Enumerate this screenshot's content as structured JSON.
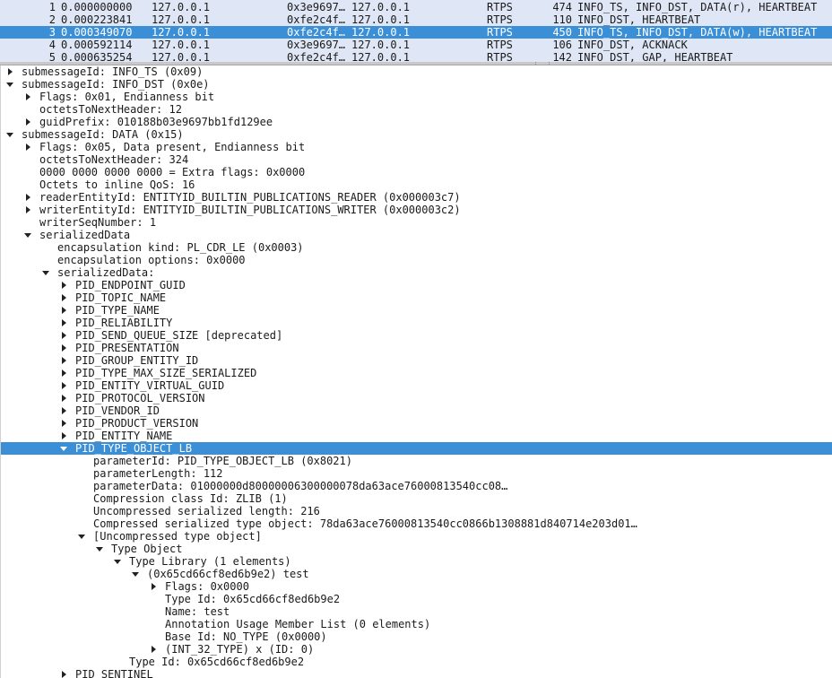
{
  "colors": {
    "selection": "#3b8fd6",
    "packet_list_bg": "#dfe6f5"
  },
  "packet_list": {
    "rows": [
      {
        "no": "1",
        "time": "0.000000000",
        "src": "127.0.0.1",
        "dst": "0x3e9697…",
        "dst2": "127.0.0.1",
        "proto": "RTPS",
        "len": "474",
        "info": "INFO_TS, INFO_DST, DATA(r), HEARTBEAT",
        "selected": false
      },
      {
        "no": "2",
        "time": "0.000223841",
        "src": "127.0.0.1",
        "dst": "0xfe2c4f…",
        "dst2": "127.0.0.1",
        "proto": "RTPS",
        "len": "110",
        "info": "INFO_DST, HEARTBEAT",
        "selected": false
      },
      {
        "no": "3",
        "time": "0.000349070",
        "src": "127.0.0.1",
        "dst": "0xfe2c4f…",
        "dst2": "127.0.0.1",
        "proto": "RTPS",
        "len": "450",
        "info": "INFO_TS, INFO_DST, DATA(w), HEARTBEAT",
        "selected": true
      },
      {
        "no": "4",
        "time": "0.000592114",
        "src": "127.0.0.1",
        "dst": "0x3e9697…",
        "dst2": "127.0.0.1",
        "proto": "RTPS",
        "len": "106",
        "info": "INFO_DST, ACKNACK",
        "selected": false
      },
      {
        "no": "5",
        "time": "0.000635254",
        "src": "127.0.0.1",
        "dst": "0xfe2c4f…",
        "dst2": "127.0.0.1",
        "proto": "RTPS",
        "len": "142",
        "info": "INFO_DST, GAP, HEARTBEAT",
        "selected": false
      }
    ]
  },
  "detail_tree": {
    "rows": [
      {
        "depth": 1,
        "expander": "collapsed",
        "text": "submessageId: INFO_TS (0x09)"
      },
      {
        "depth": 1,
        "expander": "expanded",
        "text": "submessageId: INFO_DST (0x0e)"
      },
      {
        "depth": 2,
        "expander": "collapsed",
        "text": "Flags: 0x01, Endianness bit"
      },
      {
        "depth": 2,
        "expander": "none",
        "text": "octetsToNextHeader: 12"
      },
      {
        "depth": 2,
        "expander": "collapsed",
        "text": "guidPrefix: 010188b03e9697bb1fd129ee"
      },
      {
        "depth": 1,
        "expander": "expanded",
        "text": "submessageId: DATA (0x15)"
      },
      {
        "depth": 2,
        "expander": "collapsed",
        "text": "Flags: 0x05, Data present, Endianness bit"
      },
      {
        "depth": 2,
        "expander": "none",
        "text": "octetsToNextHeader: 324"
      },
      {
        "depth": 2,
        "expander": "none",
        "text": "0000 0000 0000 0000 = Extra flags: 0x0000"
      },
      {
        "depth": 2,
        "expander": "none",
        "text": "Octets to inline QoS: 16"
      },
      {
        "depth": 2,
        "expander": "collapsed",
        "text": "readerEntityId: ENTITYID_BUILTIN_PUBLICATIONS_READER (0x000003c7)"
      },
      {
        "depth": 2,
        "expander": "collapsed",
        "text": "writerEntityId: ENTITYID_BUILTIN_PUBLICATIONS_WRITER (0x000003c2)"
      },
      {
        "depth": 2,
        "expander": "none",
        "text": "writerSeqNumber: 1"
      },
      {
        "depth": 2,
        "expander": "expanded",
        "text": "serializedData"
      },
      {
        "depth": 3,
        "expander": "none",
        "text": "encapsulation kind: PL_CDR_LE (0x0003)"
      },
      {
        "depth": 3,
        "expander": "none",
        "text": "encapsulation options: 0x0000"
      },
      {
        "depth": 3,
        "expander": "expanded",
        "text": "serializedData:"
      },
      {
        "depth": 4,
        "expander": "collapsed",
        "text": "PID_ENDPOINT_GUID"
      },
      {
        "depth": 4,
        "expander": "collapsed",
        "text": "PID_TOPIC_NAME"
      },
      {
        "depth": 4,
        "expander": "collapsed",
        "text": "PID_TYPE_NAME"
      },
      {
        "depth": 4,
        "expander": "collapsed",
        "text": "PID_RELIABILITY"
      },
      {
        "depth": 4,
        "expander": "collapsed",
        "text": "PID_SEND_QUEUE_SIZE [deprecated]"
      },
      {
        "depth": 4,
        "expander": "collapsed",
        "text": "PID_PRESENTATION"
      },
      {
        "depth": 4,
        "expander": "collapsed",
        "text": "PID_GROUP_ENTITY_ID"
      },
      {
        "depth": 4,
        "expander": "collapsed",
        "text": "PID_TYPE_MAX_SIZE_SERIALIZED"
      },
      {
        "depth": 4,
        "expander": "collapsed",
        "text": "PID_ENTITY_VIRTUAL_GUID"
      },
      {
        "depth": 4,
        "expander": "collapsed",
        "text": "PID_PROTOCOL_VERSION"
      },
      {
        "depth": 4,
        "expander": "collapsed",
        "text": "PID_VENDOR_ID"
      },
      {
        "depth": 4,
        "expander": "collapsed",
        "text": "PID_PRODUCT_VERSION"
      },
      {
        "depth": 4,
        "expander": "collapsed",
        "text": "PID_ENTITY_NAME"
      },
      {
        "depth": 4,
        "expander": "expanded",
        "text": "PID_TYPE_OBJECT_LB",
        "selected": true
      },
      {
        "depth": 5,
        "expander": "none",
        "text": "parameterId: PID_TYPE_OBJECT_LB (0x8021)"
      },
      {
        "depth": 5,
        "expander": "none",
        "text": "parameterLength: 112"
      },
      {
        "depth": 5,
        "expander": "none",
        "text": "parameterData: 01000000d80000006300000078da63ace76000813540cc08…"
      },
      {
        "depth": 5,
        "expander": "none",
        "text": "Compression class Id: ZLIB (1)"
      },
      {
        "depth": 5,
        "expander": "none",
        "text": "Uncompressed serialized length: 216"
      },
      {
        "depth": 5,
        "expander": "none",
        "text": "Compressed serialized type object: 78da63ace76000813540cc0866b1308881d840714e203d01…"
      },
      {
        "depth": 5,
        "expander": "expanded",
        "text": "[Uncompressed type object]"
      },
      {
        "depth": 6,
        "expander": "expanded",
        "text": "Type Object"
      },
      {
        "depth": 7,
        "expander": "expanded",
        "text": "Type Library (1 elements)"
      },
      {
        "depth": 8,
        "expander": "expanded",
        "text": "(0x65cd66cf8ed6b9e2) test"
      },
      {
        "depth": 9,
        "expander": "collapsed",
        "text": "Flags: 0x0000"
      },
      {
        "depth": 9,
        "expander": "none",
        "text": "Type Id: 0x65cd66cf8ed6b9e2"
      },
      {
        "depth": 9,
        "expander": "none",
        "text": "Name: test"
      },
      {
        "depth": 9,
        "expander": "none",
        "text": "Annotation Usage Member List (0 elements)"
      },
      {
        "depth": 9,
        "expander": "none",
        "text": "Base Id: NO_TYPE (0x0000)"
      },
      {
        "depth": 9,
        "expander": "collapsed",
        "text": "(INT_32_TYPE) x (ID: 0)"
      },
      {
        "depth": 7,
        "expander": "none",
        "text": "Type Id: 0x65cd66cf8ed6b9e2"
      },
      {
        "depth": 4,
        "expander": "collapsed",
        "text": "PID_SENTINEL"
      }
    ]
  }
}
